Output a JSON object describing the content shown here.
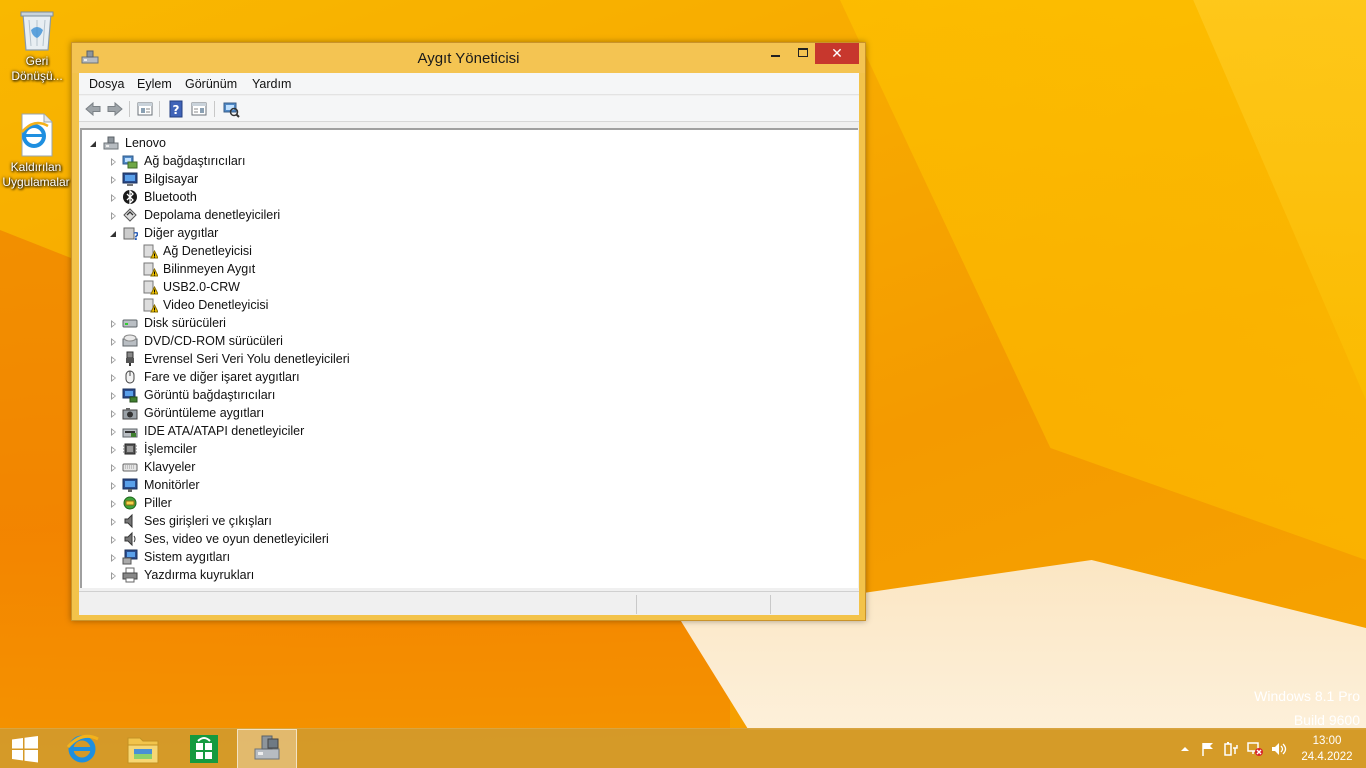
{
  "desktop": {
    "icons": [
      {
        "label": "Geri Dönüşü..."
      },
      {
        "label": "Kaldırılan Uygulamalar"
      }
    ],
    "watermark": {
      "line1": "Windows 8.1 Pro",
      "line2": "Build 9600"
    }
  },
  "window": {
    "title": "Aygıt Yöneticisi",
    "close_glyph": "✕",
    "menu": [
      "Dosya",
      "Eylem",
      "Görünüm",
      "Yardım"
    ],
    "toolbar": [
      "back-icon",
      "forward-icon",
      "properties-pane-icon",
      "help-icon",
      "view-icon",
      "scan-hardware-icon"
    ],
    "tree": {
      "root": "Lenovo",
      "items": [
        {
          "label": "Ağ bağdaştırıcıları",
          "icon": "network-adapter-icon"
        },
        {
          "label": "Bilgisayar",
          "icon": "computer-icon"
        },
        {
          "label": "Bluetooth",
          "icon": "bluetooth-icon"
        },
        {
          "label": "Depolama denetleyicileri",
          "icon": "storage-controller-icon"
        },
        {
          "label": "Diğer aygıtlar",
          "icon": "other-devices-icon",
          "expanded": true,
          "children": [
            {
              "label": "Ağ Denetleyicisi"
            },
            {
              "label": "Bilinmeyen Aygıt"
            },
            {
              "label": "USB2.0-CRW"
            },
            {
              "label": "Video Denetleyicisi"
            }
          ]
        },
        {
          "label": "Disk sürücüleri",
          "icon": "disk-drive-icon"
        },
        {
          "label": "DVD/CD-ROM sürücüleri",
          "icon": "dvd-drive-icon"
        },
        {
          "label": "Evrensel Seri Veri Yolu denetleyicileri",
          "icon": "usb-icon"
        },
        {
          "label": "Fare ve diğer işaret aygıtları",
          "icon": "mouse-icon"
        },
        {
          "label": "Görüntü bağdaştırıcıları",
          "icon": "display-adapter-icon"
        },
        {
          "label": "Görüntüleme aygıtları",
          "icon": "imaging-device-icon"
        },
        {
          "label": "IDE ATA/ATAPI denetleyiciler",
          "icon": "ide-controller-icon"
        },
        {
          "label": "İşlemciler",
          "icon": "processor-icon"
        },
        {
          "label": "Klavyeler",
          "icon": "keyboard-icon"
        },
        {
          "label": "Monitörler",
          "icon": "monitor-icon"
        },
        {
          "label": "Piller",
          "icon": "battery-icon"
        },
        {
          "label": "Ses girişleri ve çıkışları",
          "icon": "audio-io-icon"
        },
        {
          "label": "Ses, video ve oyun denetleyicileri",
          "icon": "sound-controller-icon"
        },
        {
          "label": "Sistem aygıtları",
          "icon": "system-device-icon"
        },
        {
          "label": "Yazdırma kuyrukları",
          "icon": "printer-icon"
        }
      ]
    }
  },
  "taskbar": {
    "items": [
      "start-button",
      "internet-explorer",
      "file-explorer",
      "store",
      "device-manager"
    ],
    "clock": {
      "time": "13:00",
      "date": "24.4.2022"
    }
  },
  "colors": {
    "accent": "#f4c452",
    "close": "#c7372d",
    "taskbar": "#d19a2b"
  }
}
